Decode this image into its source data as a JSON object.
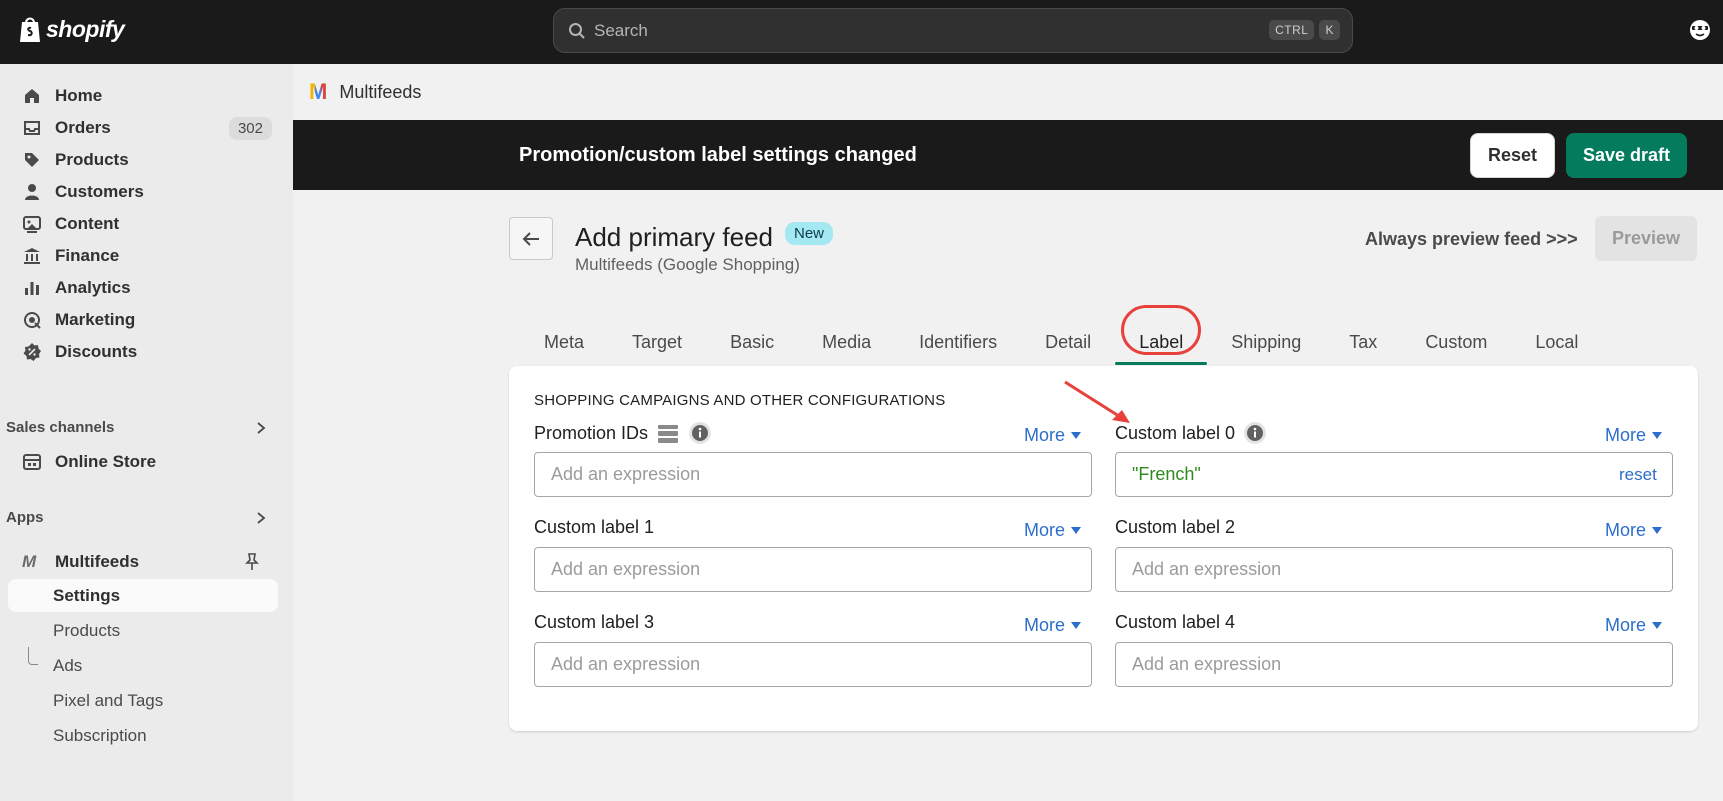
{
  "topbar": {
    "brand": "shopify",
    "search_placeholder": "Search",
    "shortcut_keys": [
      "CTRL",
      "K"
    ]
  },
  "sidebar": {
    "items": [
      {
        "label": "Home",
        "icon": "home-icon"
      },
      {
        "label": "Orders",
        "icon": "inbox-icon",
        "badge": "302"
      },
      {
        "label": "Products",
        "icon": "tag-icon"
      },
      {
        "label": "Customers",
        "icon": "person-icon"
      },
      {
        "label": "Content",
        "icon": "image-icon"
      },
      {
        "label": "Finance",
        "icon": "bank-icon"
      },
      {
        "label": "Analytics",
        "icon": "bar-chart-icon"
      },
      {
        "label": "Marketing",
        "icon": "target-icon"
      },
      {
        "label": "Discounts",
        "icon": "discount-icon"
      }
    ],
    "sales_channels_label": "Sales channels",
    "online_store_label": "Online Store",
    "apps_label": "Apps",
    "app_name": "Multifeeds",
    "app_subitems": [
      "Settings",
      "Products",
      "Ads",
      "Pixel and Tags",
      "Subscription"
    ]
  },
  "app_header": {
    "logo_letter": "M",
    "title": "Multifeeds"
  },
  "savebar": {
    "message": "Promotion/custom label settings changed",
    "reset_label": "Reset",
    "save_label": "Save draft"
  },
  "page": {
    "title": "Add primary feed",
    "badge": "New",
    "subtitle": "Multifeeds (Google Shopping)",
    "preview_hint": "Always preview feed >>>",
    "preview_label": "Preview"
  },
  "tabs": [
    "Meta",
    "Target",
    "Basic",
    "Media",
    "Identifiers",
    "Detail",
    "Label",
    "Shipping",
    "Tax",
    "Custom",
    "Local"
  ],
  "active_tab": "Label",
  "card": {
    "heading": "SHOPPING CAMPAIGNS AND OTHER CONFIGURATIONS",
    "more_label": "More",
    "placeholder": "Add an expression",
    "reset_label": "reset",
    "fields": [
      {
        "label": "Promotion IDs",
        "value": ""
      },
      {
        "label": "Custom label 0",
        "value": "\"French\""
      },
      {
        "label": "Custom label 1",
        "value": ""
      },
      {
        "label": "Custom label 2",
        "value": ""
      },
      {
        "label": "Custom label 3",
        "value": ""
      },
      {
        "label": "Custom label 4",
        "value": ""
      }
    ]
  },
  "colors": {
    "topbar_bg": "#1a1a1a",
    "save_green": "#047b5d",
    "link_blue": "#2c6ecb",
    "value_green": "#2e8b1d",
    "annotation_red": "#e8413c"
  }
}
